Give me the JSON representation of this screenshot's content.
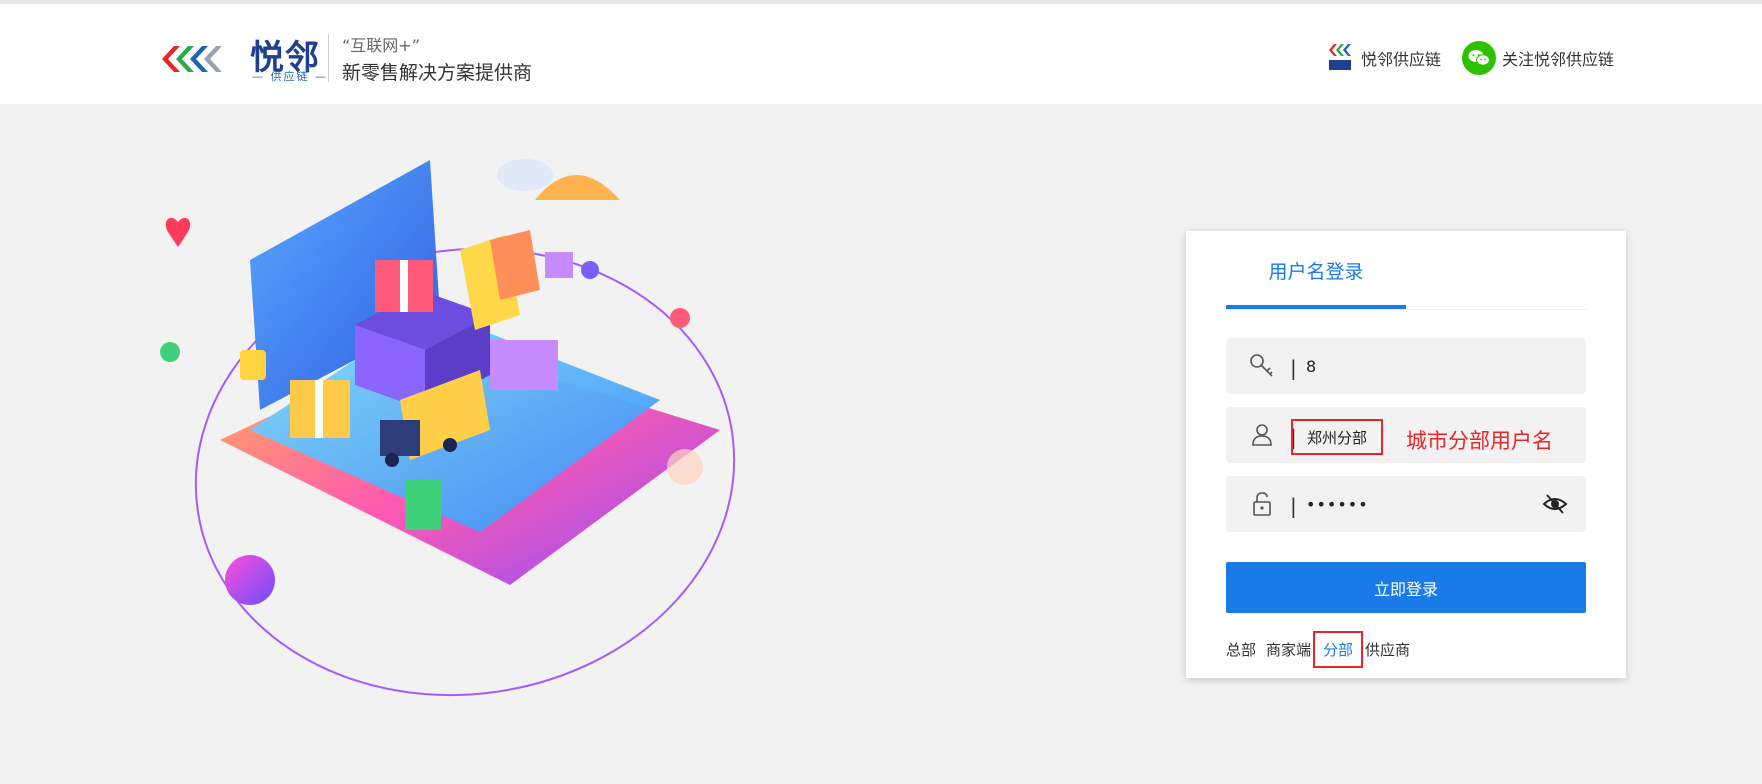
{
  "header": {
    "brand_name": "悦邻",
    "brand_sub": "— 供应链 —",
    "slogan_line1": "“互联网+”",
    "slogan_line2": "新零售解决方案提供商",
    "link_supply": "悦邻供应链",
    "link_follow": "关注悦邻供应链",
    "icons": [
      "yuelin-logo-icon",
      "wechat-icon"
    ]
  },
  "login": {
    "tab_label": "用户名登录",
    "field_code_value": "8",
    "field_branch_value": "郑州分部",
    "branch_annotation": "城市分部用户名",
    "field_password_value": "••••••",
    "submit_label": "立即登录",
    "roles": [
      {
        "label": "总部",
        "active": false
      },
      {
        "label": "商家端",
        "active": false
      },
      {
        "label": "分部",
        "active": true
      },
      {
        "label": "供应商",
        "active": false
      }
    ],
    "icons": [
      "key-icon",
      "user-icon",
      "lock-icon",
      "eye-icon"
    ]
  },
  "colors": {
    "accent": "#1a7be8",
    "annotation_red": "#e8262a",
    "wechat_green": "#2dc100",
    "page_bg": "#f2f2f2"
  }
}
